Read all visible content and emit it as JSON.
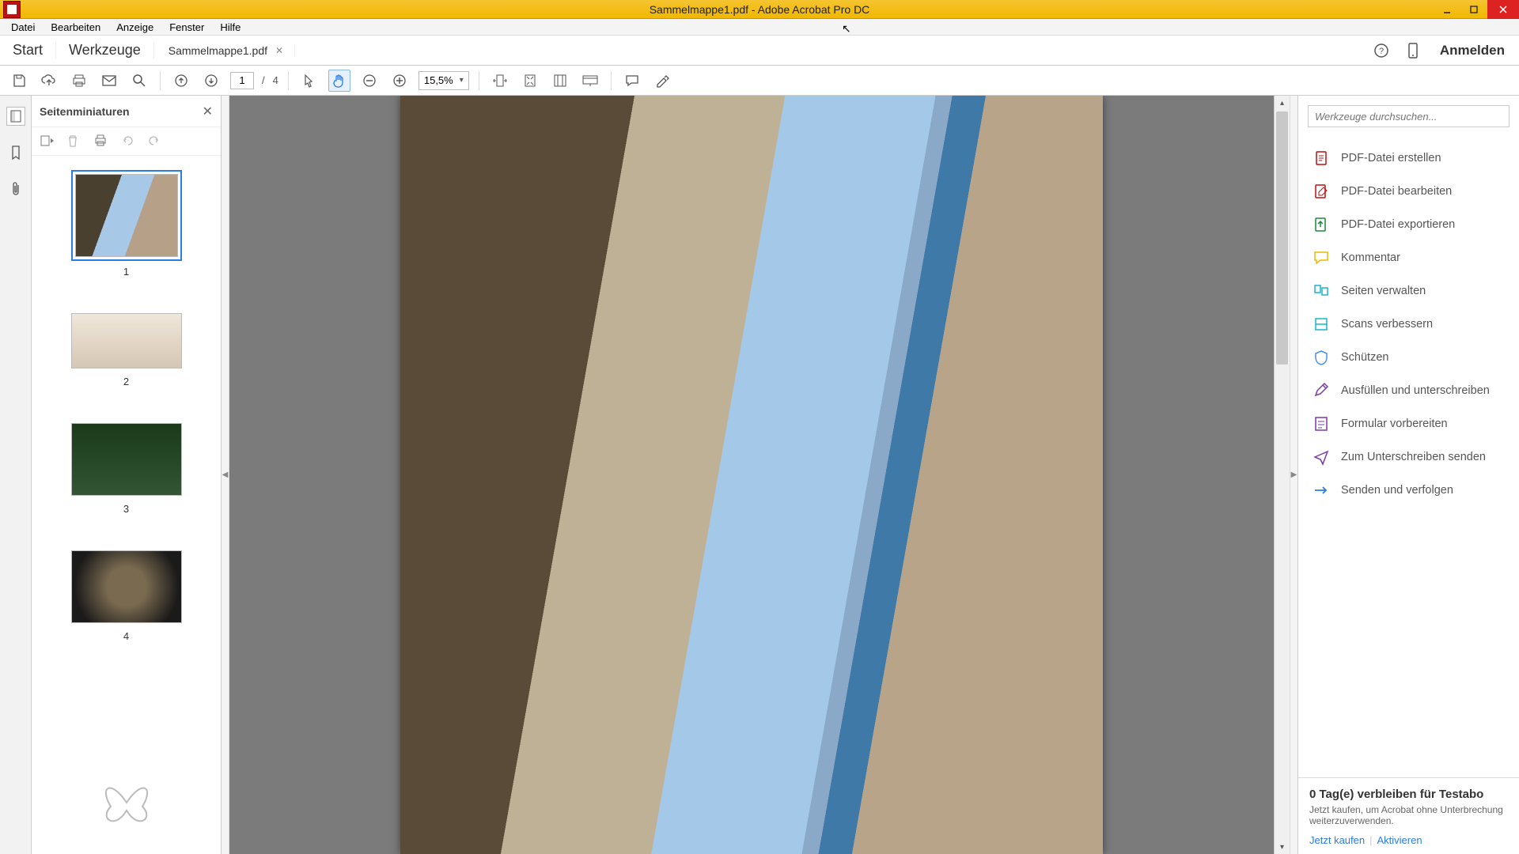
{
  "window": {
    "title": "Sammelmappe1.pdf - Adobe Acrobat Pro DC"
  },
  "menu": {
    "items": [
      "Datei",
      "Bearbeiten",
      "Anzeige",
      "Fenster",
      "Hilfe"
    ]
  },
  "tabs": {
    "start": "Start",
    "tools": "Werkzeuge",
    "document": "Sammelmappe1.pdf",
    "signin": "Anmelden"
  },
  "toolbar": {
    "page_current": "1",
    "page_sep": "/",
    "page_total": "4",
    "zoom": "15,5%"
  },
  "thumbs": {
    "title": "Seitenminiaturen",
    "labels": [
      "1",
      "2",
      "3",
      "4"
    ]
  },
  "search": {
    "placeholder": "Werkzeuge durchsuchen..."
  },
  "tools_list": [
    {
      "icon": "#b11",
      "svg": "file",
      "label": "PDF-Datei erstellen"
    },
    {
      "icon": "#b11",
      "svg": "edit",
      "label": "PDF-Datei bearbeiten"
    },
    {
      "icon": "#1a8a3a",
      "svg": "export",
      "label": "PDF-Datei exportieren"
    },
    {
      "icon": "#f0b800",
      "svg": "comment",
      "label": "Kommentar"
    },
    {
      "icon": "#1ab5c8",
      "svg": "pages",
      "label": "Seiten verwalten"
    },
    {
      "icon": "#1ab5c8",
      "svg": "scan",
      "label": "Scans verbessern"
    },
    {
      "icon": "#4a90e2",
      "svg": "shield",
      "label": "Schützen"
    },
    {
      "icon": "#7a3aa8",
      "svg": "pen",
      "label": "Ausfüllen und unterschreiben"
    },
    {
      "icon": "#7a3aa8",
      "svg": "form",
      "label": "Formular vorbereiten"
    },
    {
      "icon": "#7a3aa8",
      "svg": "send-sign",
      "label": "Zum Unterschreiben senden"
    },
    {
      "icon": "#2a7de1",
      "svg": "send",
      "label": "Senden und verfolgen"
    }
  ],
  "promo": {
    "title": "0 Tag(e) verbleiben für Testabo",
    "text": "Jetzt kaufen, um Acrobat ohne Unterbrechung weiterzuverwenden.",
    "buy": "Jetzt kaufen",
    "activate": "Aktivieren"
  }
}
